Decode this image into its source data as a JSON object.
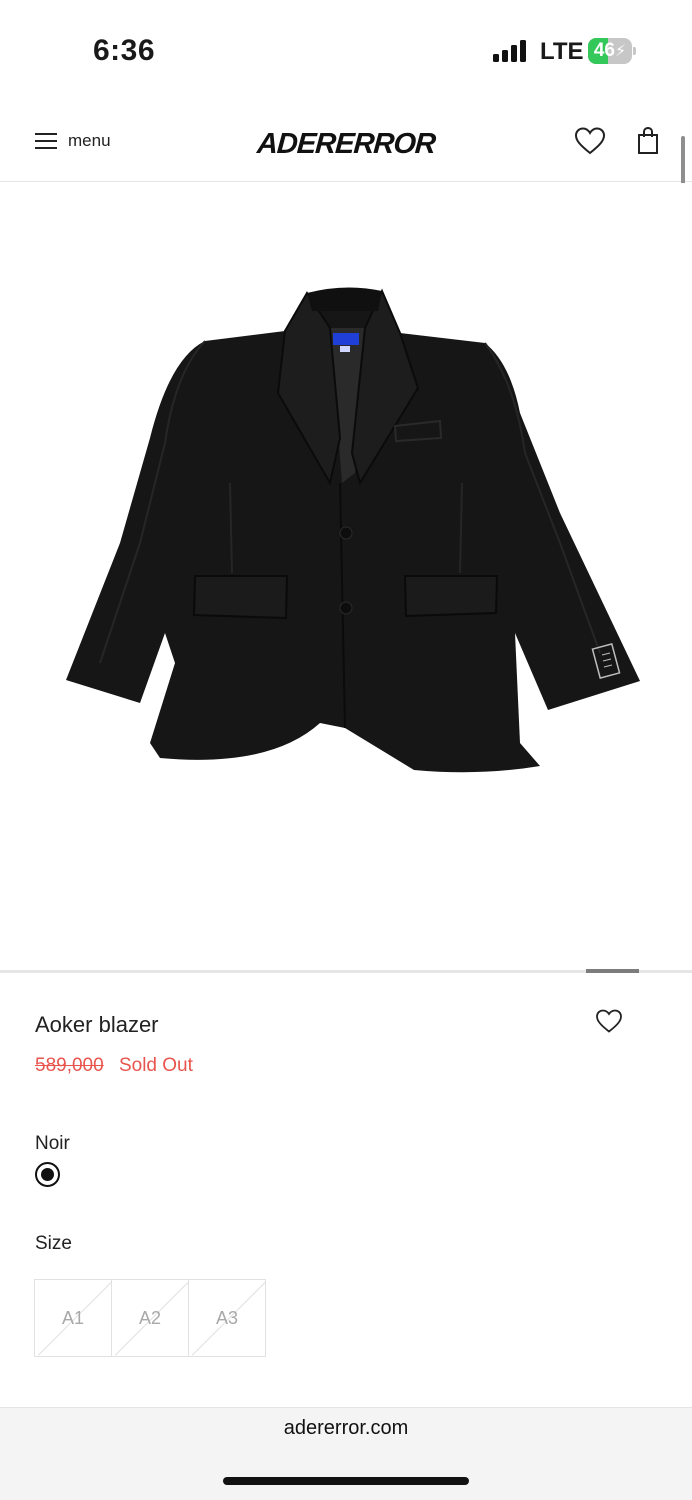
{
  "status_bar": {
    "time": "6:36",
    "network": "LTE",
    "battery": "46",
    "battery_level": 0.46
  },
  "header": {
    "menu_label": "menu",
    "logo": "ADERERROR",
    "icons": [
      "hamburger-icon",
      "heart-icon",
      "shopping-bag-icon"
    ]
  },
  "product": {
    "image_alt": "black-blazer",
    "name": "Aoker blazer",
    "price_original": "589,000",
    "status": "Sold Out",
    "color_label": "Noir",
    "size_label": "Size",
    "sizes": [
      "A1",
      "A2",
      "A3"
    ]
  },
  "browser": {
    "url": "adererror.com"
  },
  "colors": {
    "sale_red": "#e8554e",
    "battery_green": "#34c759",
    "blazer": "#161616",
    "label_blue": "#1f3fd6"
  }
}
